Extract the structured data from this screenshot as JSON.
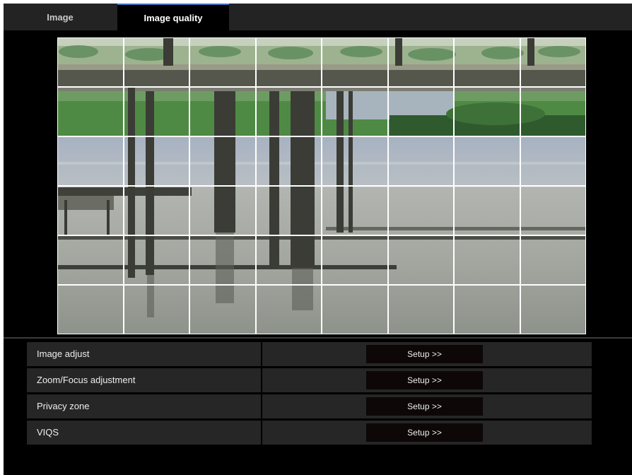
{
  "tabs": [
    {
      "label": "Image",
      "active": false
    },
    {
      "label": "Image quality",
      "active": true
    }
  ],
  "preview": {
    "description": "camera live image with grid overlay",
    "grid": {
      "columns": 8,
      "rows": 6
    },
    "colors": {
      "grid_line": "#ffffff",
      "active_tab_accent": "#3a76c4"
    }
  },
  "settings": [
    {
      "label": "Image adjust",
      "button": "Setup >>"
    },
    {
      "label": "Zoom/Focus adjustment",
      "button": "Setup >>"
    },
    {
      "label": "Privacy zone",
      "button": "Setup >>"
    },
    {
      "label": "VIQS",
      "button": "Setup >>"
    }
  ]
}
